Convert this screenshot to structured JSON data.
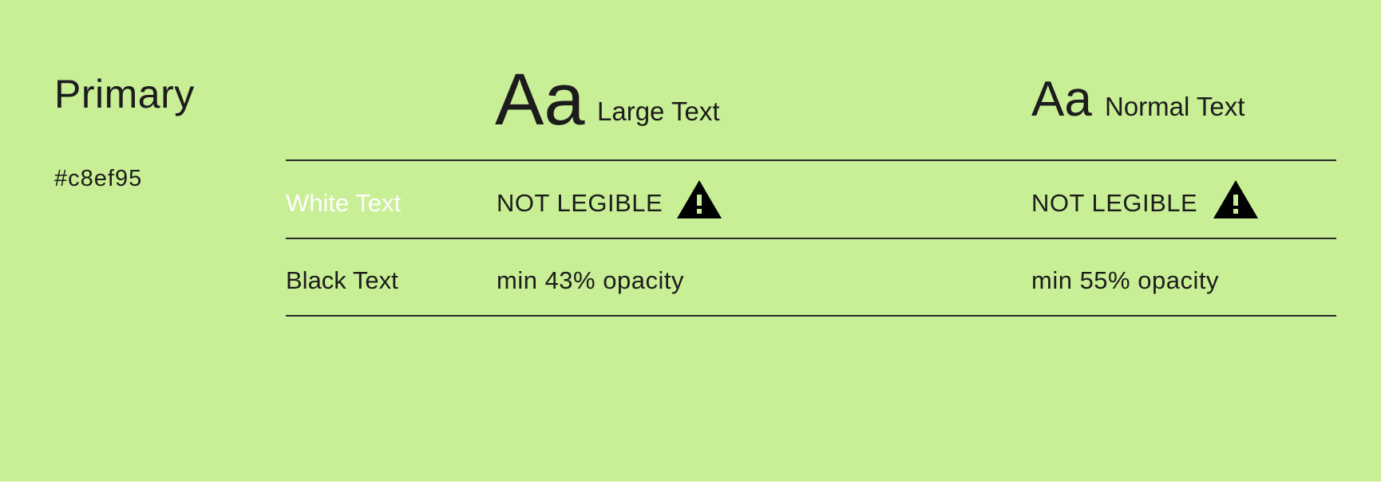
{
  "swatch": {
    "name": "Primary",
    "hex": "#c8ef95",
    "background_color": "#c8ef95"
  },
  "columns": {
    "large": {
      "sample": "Aa",
      "label": "Large Text"
    },
    "normal": {
      "sample": "Aa",
      "label": "Normal Text"
    }
  },
  "rows": [
    {
      "label": "White Text",
      "text_color": "#ffffff",
      "large": "NOT LEGIBLE",
      "normal": "NOT LEGIBLE",
      "icon": "warning-icon"
    },
    {
      "label": "Black Text",
      "text_color": "#000000",
      "large": "min 43% opacity",
      "normal": "min 55% opacity"
    }
  ]
}
